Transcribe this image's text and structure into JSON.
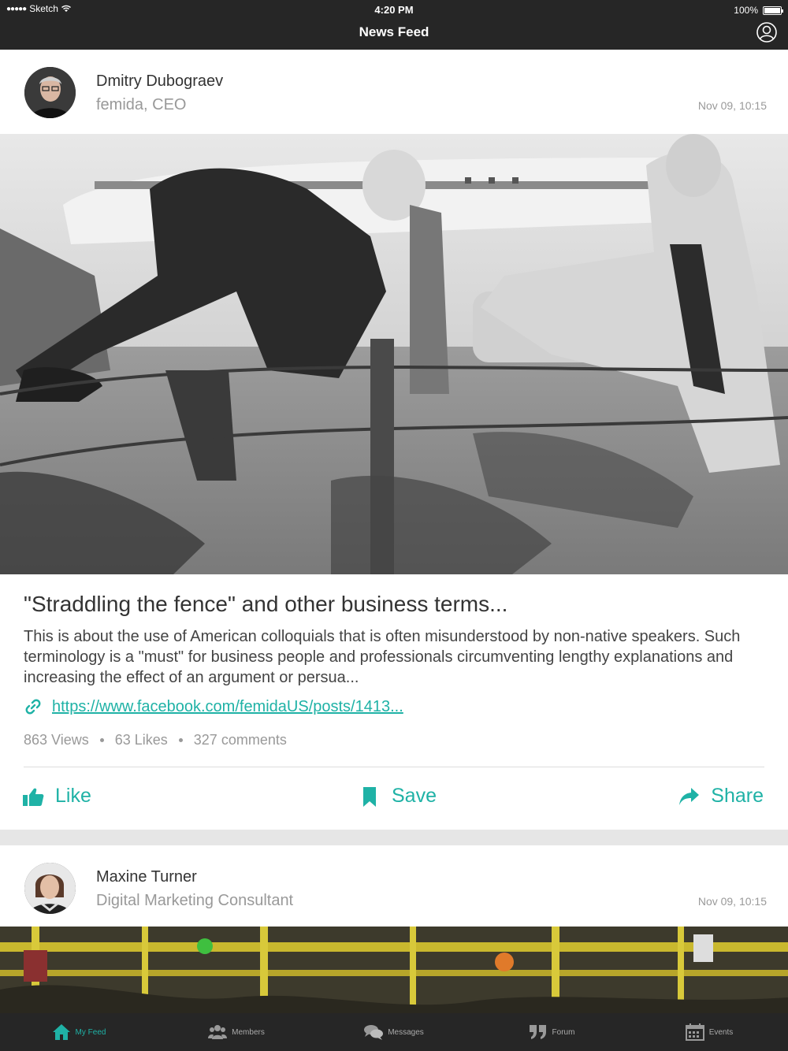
{
  "status_bar": {
    "carrier": "Sketch",
    "time": "4:20 PM",
    "battery": "100%",
    "battery_level": 1.0
  },
  "nav": {
    "title": "News Feed",
    "profile_icon": "user-circle-icon"
  },
  "posts": [
    {
      "author": "Dmitry Dubograev",
      "role": "femida, CEO",
      "time": "Nov 09, 10:15",
      "title": "\"Straddling the fence\" and other business terms...",
      "body": "This is about the use of American colloquials that is often misunderstood by non-native speakers. Such terminology is a \"must\" for business people and professionals circumventing lengthy explanations and increasing the effect of an argument or persua...",
      "link": "https://www.facebook.com/femidaUS/posts/1413...",
      "views": "863 Views",
      "likes": "63 Likes",
      "comments": "327 comments"
    },
    {
      "author": "Maxine Turner",
      "role": "Digital Marketing Consultant",
      "time": "Nov 09, 10:15"
    }
  ],
  "actions": {
    "like": "Like",
    "save": "Save",
    "share": "Share"
  },
  "tabs": [
    {
      "label": "My Feed",
      "icon": "home-icon",
      "active": true
    },
    {
      "label": "Members",
      "icon": "members-icon",
      "active": false
    },
    {
      "label": "Messages",
      "icon": "messages-icon",
      "active": false
    },
    {
      "label": "Forum",
      "icon": "quote-icon",
      "active": false
    },
    {
      "label": "Events",
      "icon": "calendar-icon",
      "active": false
    }
  ],
  "colors": {
    "accent": "#1fb2a6",
    "bar": "#262626",
    "muted": "#999999"
  }
}
